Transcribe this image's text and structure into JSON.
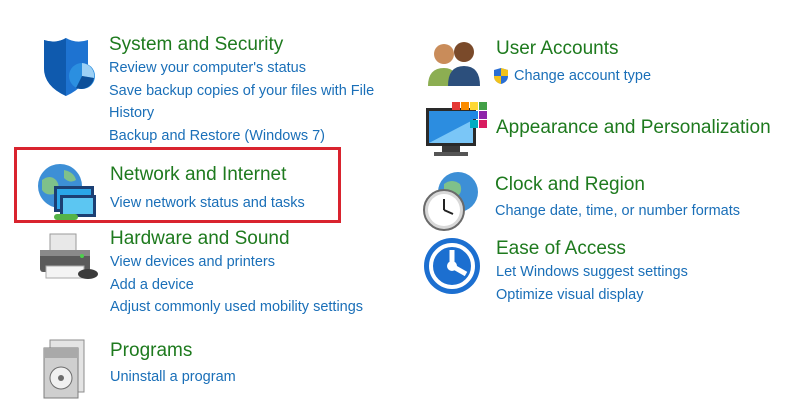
{
  "left": {
    "system": {
      "title": "System and Security",
      "links": [
        "Review your computer's status",
        "Save backup copies of your files with File History",
        "Backup and Restore (Windows 7)"
      ]
    },
    "network": {
      "title": "Network and Internet",
      "links": [
        "View network status and tasks"
      ]
    },
    "hardware": {
      "title": "Hardware and Sound",
      "links": [
        "View devices and printers",
        "Add a device",
        "Adjust commonly used mobility settings"
      ]
    },
    "programs": {
      "title": "Programs",
      "links": [
        "Uninstall a program"
      ]
    }
  },
  "right": {
    "users": {
      "title": "User Accounts",
      "links": [
        "Change account type"
      ]
    },
    "appearance": {
      "title": "Appearance and Personalization",
      "links": []
    },
    "clock": {
      "title": "Clock and Region",
      "links": [
        "Change date, time, or number formats"
      ]
    },
    "ease": {
      "title": "Ease of Access",
      "links": [
        "Let Windows suggest settings",
        "Optimize visual display"
      ]
    }
  },
  "colors": {
    "title_green": "#1e7a1e",
    "link_blue": "#1a6fb8",
    "highlight_red": "#d9232e"
  }
}
